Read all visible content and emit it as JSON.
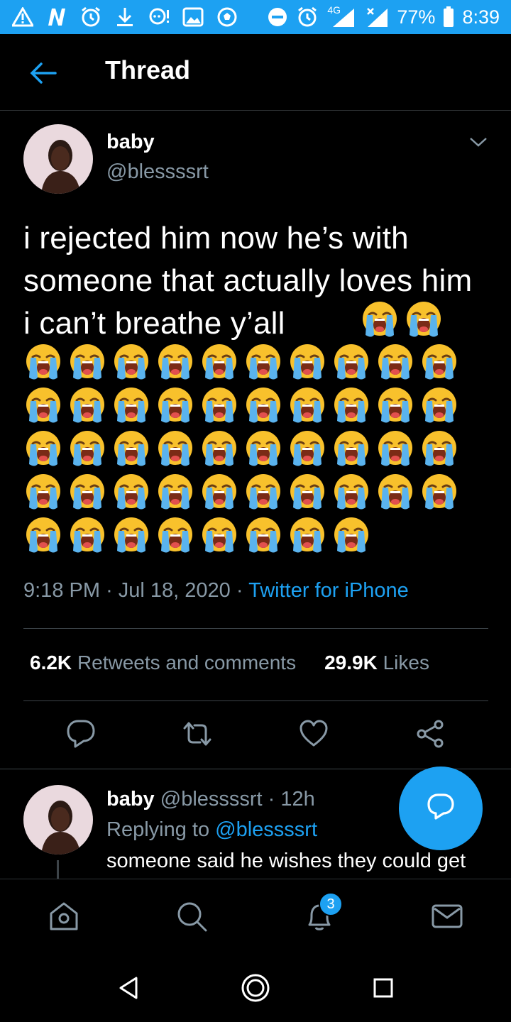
{
  "status_bar": {
    "network": "4G",
    "battery": "77%",
    "time": "8:39",
    "icons": [
      "warning-icon",
      "n-icon",
      "alarm-icon",
      "download-icon",
      "chat-icon",
      "image-icon",
      "soccer-icon",
      "dnd-icon",
      "alarm-icon",
      "signal-icon",
      "signal-x-icon",
      "battery-icon"
    ]
  },
  "header": {
    "title": "Thread"
  },
  "tweet": {
    "name": "baby",
    "handle": "@blessssrt",
    "text": "i rejected him now he’s with someone that actually loves him i can’t breathe y’all",
    "emoji": "loudly-crying-face",
    "inline_emoji_count": 2,
    "grid_rows": [
      10,
      10,
      10,
      10,
      8
    ],
    "time": "9:18 PM",
    "date": "Jul 18, 2020",
    "source": "Twitter for iPhone",
    "separator": "·",
    "retweets_count": "6.2K",
    "retweets_label": "Retweets and comments",
    "likes_count": "29.9K",
    "likes_label": "Likes"
  },
  "reply": {
    "name": "baby",
    "handle": "@blessssrt",
    "age": "12h",
    "replying_prefix": "Replying to",
    "replying_to": "@blessssrt",
    "text": "someone said he wishes they could get"
  },
  "bottom_nav": {
    "notifications_badge": "3"
  },
  "colors": {
    "accent": "#1da1f2",
    "muted": "#8899a6",
    "background": "#000000"
  }
}
